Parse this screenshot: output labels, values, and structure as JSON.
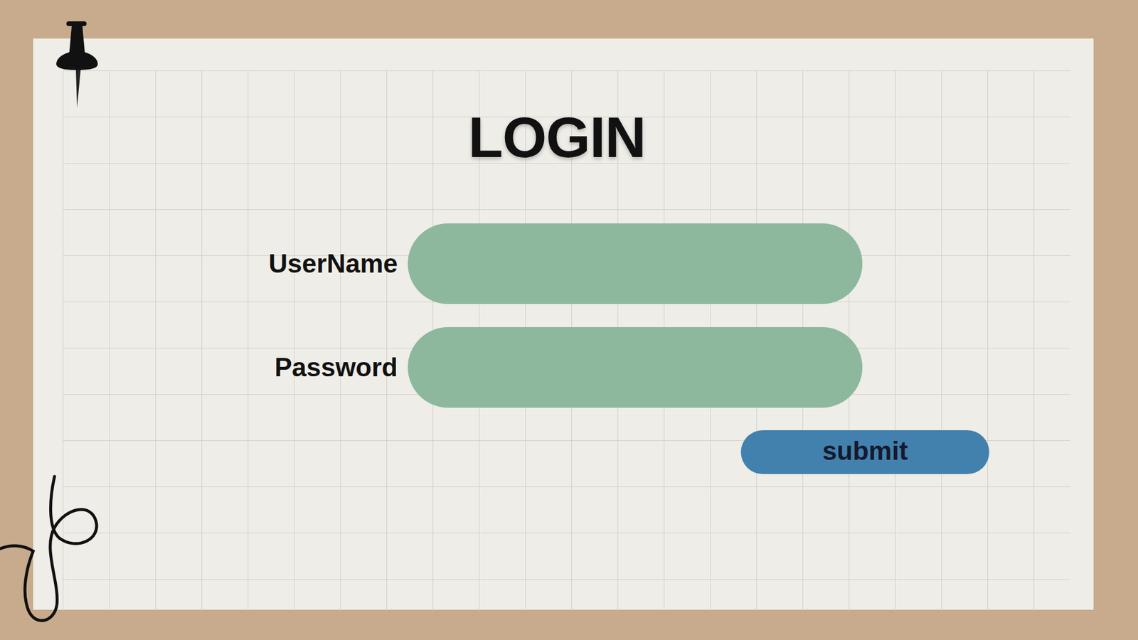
{
  "title": "LOGIN",
  "fields": [
    {
      "label": "UserName"
    },
    {
      "label": "Password"
    }
  ],
  "submit": "submit"
}
